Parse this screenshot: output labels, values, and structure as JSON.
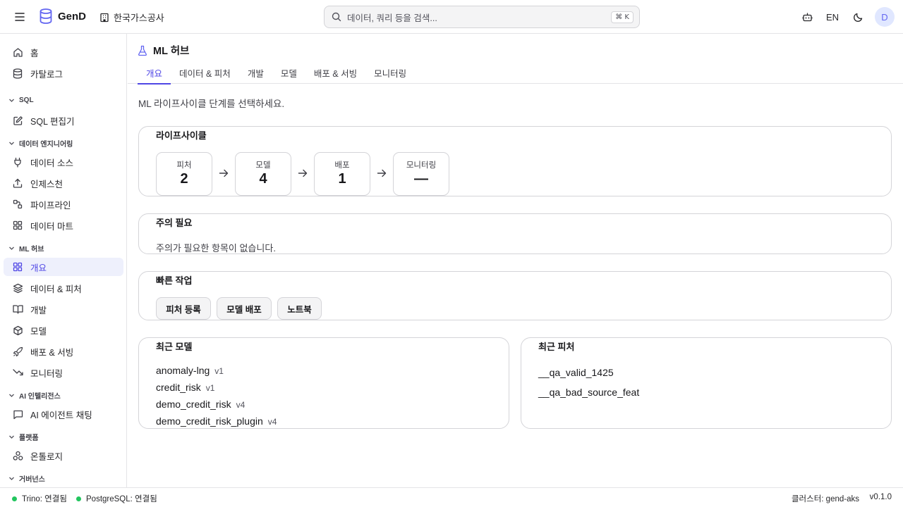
{
  "header": {
    "brand": "GenD",
    "org": "한국가스공사",
    "search_placeholder": "데이터, 쿼리 등을 검색...",
    "shortcut": "⌘ K",
    "lang": "EN",
    "avatar": "D"
  },
  "sidebar": {
    "top": [
      {
        "label": "홈",
        "icon": "home-icon"
      },
      {
        "label": "카탈로그",
        "icon": "database-icon"
      }
    ],
    "sections": {
      "sql": "SQL",
      "data_eng": "데이터 엔지니어링",
      "ml_hub": "ML 허브",
      "ai": "AI 인텔리전스",
      "platform": "플랫폼",
      "governance": "거버넌스"
    },
    "sql_items": [
      {
        "label": "SQL 편집기",
        "icon": "edit-icon"
      }
    ],
    "data_eng_items": [
      {
        "label": "데이터 소스",
        "icon": "plug-icon"
      },
      {
        "label": "인제스천",
        "icon": "upload-icon"
      },
      {
        "label": "파이프라인",
        "icon": "pipeline-icon"
      },
      {
        "label": "데이터 마트",
        "icon": "grid-icon"
      }
    ],
    "ml_items": [
      {
        "label": "개요",
        "icon": "grid-icon"
      },
      {
        "label": "데이터 & 피처",
        "icon": "layers-icon"
      },
      {
        "label": "개발",
        "icon": "book-icon"
      },
      {
        "label": "모델",
        "icon": "box-icon"
      },
      {
        "label": "배포 & 서빙",
        "icon": "rocket-icon"
      },
      {
        "label": "모니터링",
        "icon": "trend-down-icon"
      }
    ],
    "ai_items": [
      {
        "label": "AI 에이전트 채팅",
        "icon": "chat-icon"
      }
    ],
    "platform_items": [
      {
        "label": "온톨로지",
        "icon": "ontology-icon"
      }
    ]
  },
  "page": {
    "title": "ML 허브",
    "tabs": [
      "개요",
      "데이터 & 피처",
      "개발",
      "모델",
      "배포 & 서빙",
      "모니터링"
    ],
    "subtitle": "ML 라이프사이클 단계를 선택하세요."
  },
  "lifecycle": {
    "title": "라이프사이클",
    "stages": [
      {
        "label": "피처",
        "value": "2"
      },
      {
        "label": "모델",
        "value": "4"
      },
      {
        "label": "배포",
        "value": "1"
      },
      {
        "label": "모니터링",
        "value": "—"
      }
    ]
  },
  "attention": {
    "title": "주의 필요",
    "empty": "주의가 필요한 항목이 없습니다."
  },
  "quick": {
    "title": "빠른 작업",
    "buttons": [
      "피처 등록",
      "모델 배포",
      "노트북"
    ]
  },
  "recent_models": {
    "title": "최근 모델",
    "items": [
      {
        "name": "anomaly-lng",
        "version": "v1"
      },
      {
        "name": "credit_risk",
        "version": "v1"
      },
      {
        "name": "demo_credit_risk",
        "version": "v4"
      },
      {
        "name": "demo_credit_risk_plugin",
        "version": "v4"
      }
    ]
  },
  "recent_features": {
    "title": "최근 피처",
    "items": [
      "__qa_valid_1425",
      "__qa_bad_source_feat"
    ]
  },
  "footer": {
    "trino": "Trino: 연결됨",
    "postgres": "PostgreSQL: 연결됨",
    "cluster": "클러스터: gend-aks",
    "version": "v0.1.0"
  },
  "colors": {
    "accent": "#4f46e5",
    "status_ok": "#22c55e"
  }
}
